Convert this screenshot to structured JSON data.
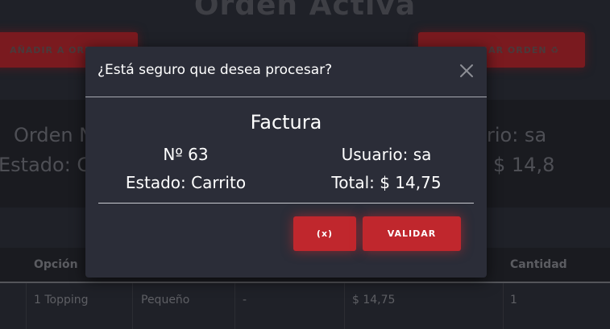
{
  "page": {
    "title": "Orden Activa",
    "add_button": "AÑADIR A ORDEN ⊕",
    "process_button": "PROCESAR ORDEN ♻",
    "info_left_1": "Orden N",
    "info_left_2": "Estado: C",
    "info_right_1": "rio: sa",
    "info_right_2": "$ 14,8"
  },
  "table": {
    "headers": [
      "Opción",
      "Cantidad"
    ],
    "row": {
      "opcion": "1 Topping",
      "tamano": "Pequeño",
      "extra": "-",
      "precio": "$ 14,75",
      "cantidad": "1"
    }
  },
  "modal": {
    "title": "¿Está seguro que desea procesar?",
    "invoice_title": "Factura",
    "number": "Nº 63",
    "user": "Usuario: sa",
    "status": "Estado: Carrito",
    "total": "Total: $ 14,75",
    "cancel_label": "(x)",
    "validate_label": "VALIDAR",
    "close_icon": "close-icon"
  },
  "colors": {
    "accent": "#c0272d",
    "modal_bg": "#2b2d38",
    "page_bg": "#1f2128"
  }
}
